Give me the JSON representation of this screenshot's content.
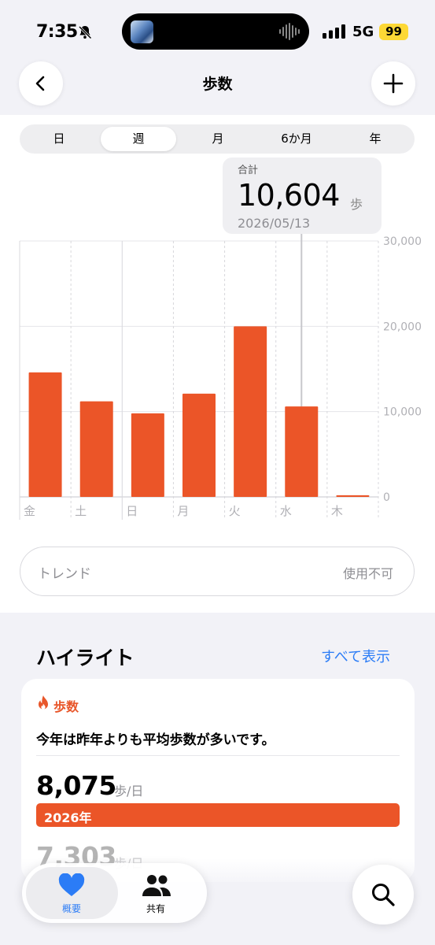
{
  "status_bar": {
    "time": "7:35",
    "network": "5G",
    "battery": "99"
  },
  "nav": {
    "title": "歩数",
    "back_icon": "chevron-left-icon",
    "add_icon": "plus-icon"
  },
  "segments": {
    "items": [
      "日",
      "週",
      "月",
      "6か月",
      "年"
    ],
    "selected": "週"
  },
  "tooltip": {
    "label": "合計",
    "value": "10,604",
    "unit": "歩",
    "date": "2026/05/13"
  },
  "chart_data": {
    "type": "bar",
    "categories": [
      "金",
      "土",
      "日",
      "月",
      "火",
      "水",
      "木"
    ],
    "values": [
      14600,
      11200,
      9800,
      12100,
      20000,
      10604,
      200
    ],
    "yticks": [
      "0",
      "10,000",
      "20,000",
      "30,000"
    ],
    "ylim": [
      0,
      30000
    ],
    "selected_index": 5,
    "bar_color": "#eb5528"
  },
  "trend": {
    "label": "トレンド",
    "value": "使用不可"
  },
  "highlights": {
    "title": "ハイライト",
    "show_all": "すべて表示",
    "card": {
      "category": "歩数",
      "message": "今年は昨年よりも平均歩数が多いです。",
      "current_value": "8,075",
      "current_unit": "歩/日",
      "current_year": "2026年",
      "previous_value": "7,303",
      "previous_unit": "歩/日"
    }
  },
  "tabs": [
    {
      "label": "概要",
      "icon": "heart-icon"
    },
    {
      "label": "共有",
      "icon": "people-icon"
    }
  ],
  "search_icon": "search-icon",
  "colors": {
    "accent": "#eb5528",
    "link": "#2b7cf6",
    "tab_active": "#2b7cf6"
  }
}
